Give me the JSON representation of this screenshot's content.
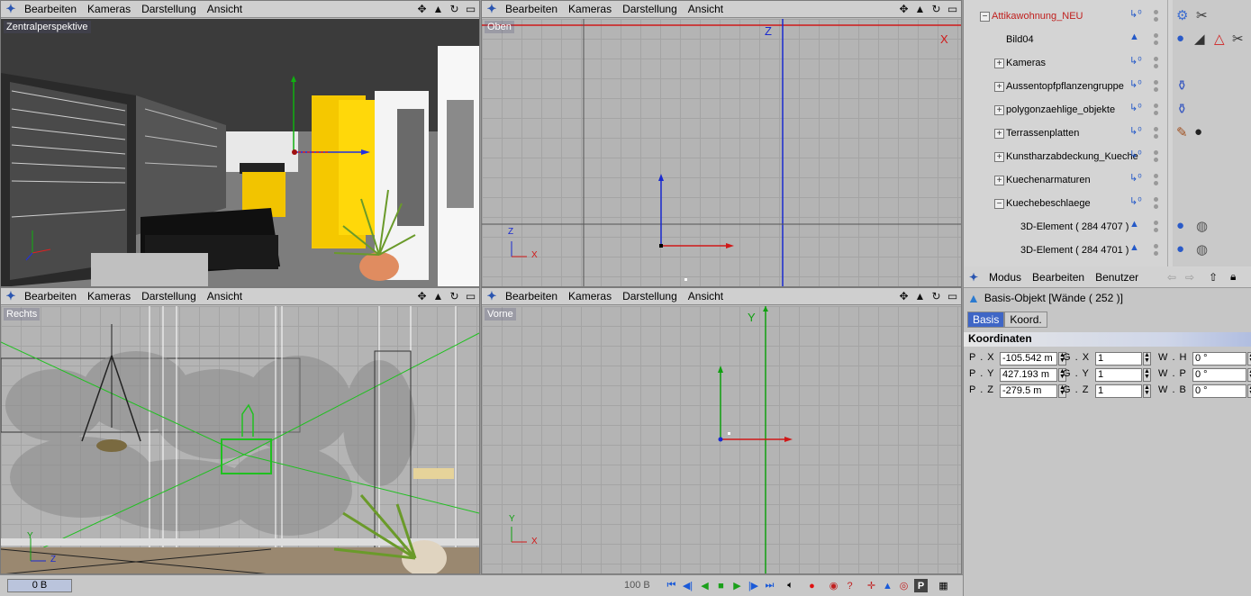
{
  "viewport_menu": [
    "Bearbeiten",
    "Kameras",
    "Darstellung",
    "Ansicht"
  ],
  "viewports": {
    "perspective": {
      "label": "Zentralperspektive"
    },
    "top": {
      "label": "Oben",
      "axis_x": "X",
      "axis_z": "Z"
    },
    "right": {
      "label": "Rechts",
      "axis_y": "Y",
      "axis_z": "Z"
    },
    "front": {
      "label": "Vorne",
      "axis_y": "Y",
      "axis_x": "X"
    }
  },
  "object_manager": {
    "rows": [
      {
        "name": "Attikawohnung_NEU",
        "expander": "−",
        "indent": 0,
        "highlight": true
      },
      {
        "name": "Bild04",
        "expander": "",
        "indent": 1
      },
      {
        "name": "Kameras",
        "expander": "+",
        "indent": 1
      },
      {
        "name": "Aussentopfpflanzengruppe",
        "expander": "+",
        "indent": 1
      },
      {
        "name": "polygonzaehlige_objekte",
        "expander": "+",
        "indent": 1
      },
      {
        "name": "Terrassenplatten",
        "expander": "+",
        "indent": 1
      },
      {
        "name": "Kunstharzabdeckung_Kueche",
        "expander": "+",
        "indent": 1
      },
      {
        "name": "Kuechenarmaturen",
        "expander": "+",
        "indent": 1
      },
      {
        "name": "Kuechebeschlaege",
        "expander": "−",
        "indent": 1
      },
      {
        "name": "3D-Element ( 284 4707 )",
        "expander": "",
        "indent": 2
      },
      {
        "name": "3D-Element ( 284 4701 )",
        "expander": "",
        "indent": 2
      }
    ]
  },
  "attribute_manager": {
    "menu": [
      "Modus",
      "Bearbeiten",
      "Benutzer"
    ],
    "title": "Basis-Objekt [Wände ( 252 )]",
    "tabs": [
      "Basis",
      "Koord."
    ],
    "section": "Koordinaten",
    "coords": [
      {
        "p_label": "P . X",
        "p_value": "-105.542 m",
        "g_label": "G . X",
        "g_value": "1",
        "w_label": "W . H",
        "w_value": "0 °"
      },
      {
        "p_label": "P . Y",
        "p_value": "427.193 m",
        "g_label": "G . Y",
        "g_value": "1",
        "w_label": "W . P",
        "w_value": "0 °"
      },
      {
        "p_label": "P . Z",
        "p_value": "-279.5 m",
        "g_label": "G . Z",
        "g_value": "1",
        "w_label": "W . B",
        "w_value": "0 °"
      }
    ]
  },
  "timeline": {
    "current_frame": "0 B",
    "end_frame": "100 B"
  },
  "colors": {
    "accent": "#3f66c6",
    "highlight_text": "#c0201e",
    "axis_x": "#d01818",
    "axis_y": "#10a010",
    "axis_z": "#1a2ad0"
  }
}
